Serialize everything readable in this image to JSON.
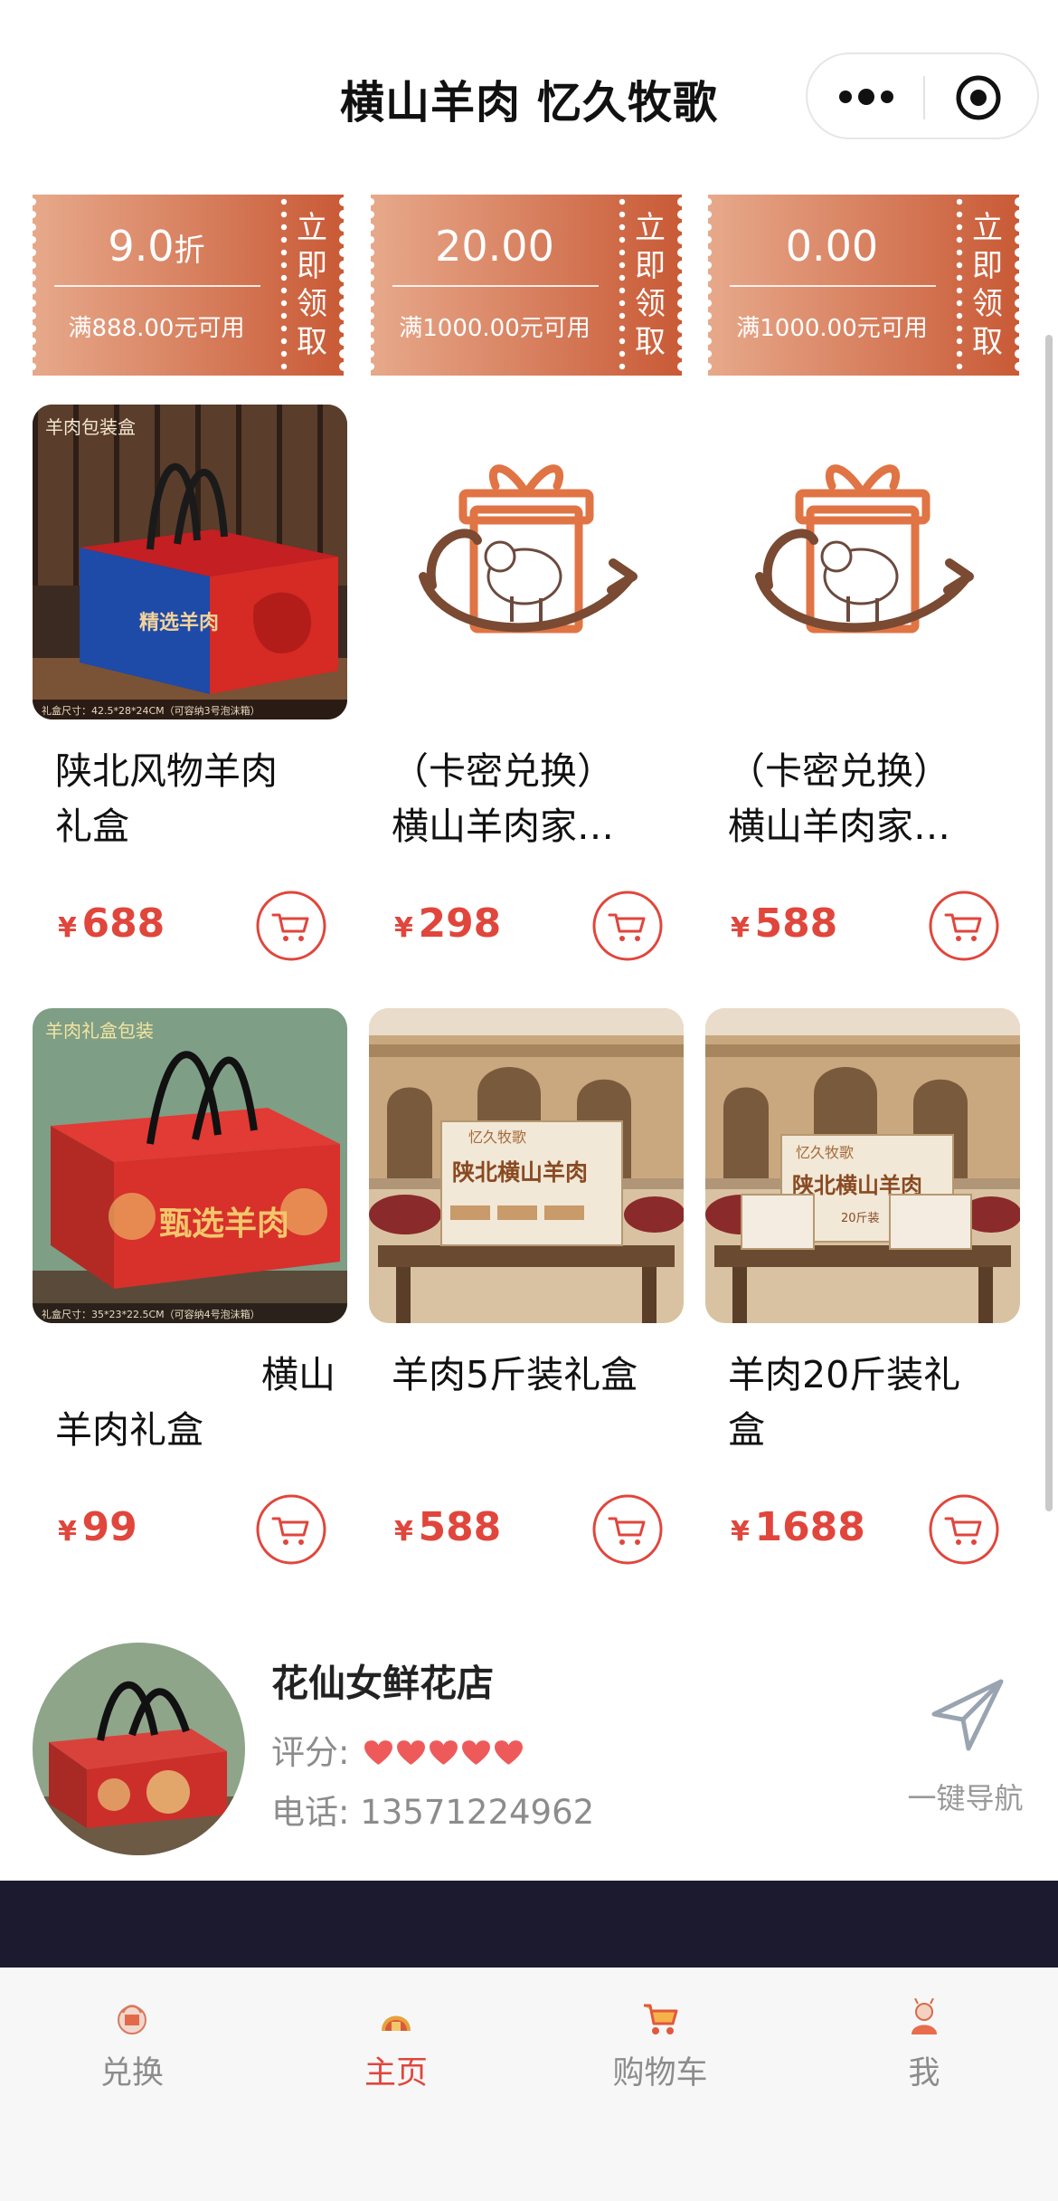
{
  "header": {
    "title": "横山羊肉 忆久牧歌"
  },
  "coupons": [
    {
      "value": "9.0",
      "unit": "折",
      "condition": "满888.00元可用",
      "claim": [
        "立",
        "即",
        "领",
        "取"
      ]
    },
    {
      "value": "20.00",
      "unit": "",
      "condition": "满1000.00元可用",
      "claim": [
        "立",
        "即",
        "领",
        "取"
      ]
    },
    {
      "value": "0.00",
      "unit": "",
      "condition": "满1000.00元可用",
      "claim": [
        "立",
        "即",
        "领",
        "取"
      ]
    }
  ],
  "products": [
    {
      "name_lines": [
        "陕北风物羊肉",
        "礼盒"
      ],
      "currency": "¥",
      "price": "688",
      "image": "gift-box-red-blue"
    },
    {
      "name_lines": [
        "（卡密兑换）",
        "横山羊肉家…"
      ],
      "currency": "¥",
      "price": "298",
      "image": "gift-sheep-logo"
    },
    {
      "name_lines": [
        "（卡密兑换）",
        "横山羊肉家…"
      ],
      "currency": "¥",
      "price": "588",
      "image": "gift-sheep-logo"
    },
    {
      "name_lines": [
        "横山",
        "羊肉礼盒"
      ],
      "currency": "¥",
      "price": "99",
      "image": "gift-box-red"
    },
    {
      "name_lines": [
        "羊肉5斤装礼盒",
        ""
      ],
      "currency": "¥",
      "price": "588",
      "image": "cave-house-box"
    },
    {
      "name_lines": [
        "羊肉20斤装礼",
        "盒"
      ],
      "currency": "¥",
      "price": "1688",
      "image": "cave-house-boxes"
    }
  ],
  "image_texts": {
    "box1_header": "羊肉包装盒",
    "box1_label": "精选羊肉",
    "box1_size": "礼盒尺寸：42.5*28*24CM（可容纳3号泡沫箱）",
    "box2_header": "羊肉礼盒包装",
    "box2_label": "甄选羊肉",
    "box2_size": "礼盒尺寸：35*23*22.5CM（可容纳4号泡沫箱）",
    "brand": "忆久牧歌",
    "box_label": "陕北横山羊肉",
    "weight_20": "20斤装"
  },
  "store": {
    "name": "花仙女鲜花店",
    "rating_label": "评分:",
    "rating": 5,
    "phone_label": "电话:",
    "phone": "13571224962",
    "navigate_label": "一键导航"
  },
  "tabbar": [
    {
      "label": "兑换",
      "icon": "exchange-icon",
      "active": false
    },
    {
      "label": "主页",
      "icon": "home-icon",
      "active": true
    },
    {
      "label": "购物车",
      "icon": "cart-icon",
      "active": false
    },
    {
      "label": "我",
      "icon": "profile-icon",
      "active": false
    }
  ],
  "colors": {
    "accent": "#e0463c",
    "coupon_light": "#e7a98b",
    "coupon_dark": "#c95a36",
    "dark_band": "#1b1a2e"
  }
}
